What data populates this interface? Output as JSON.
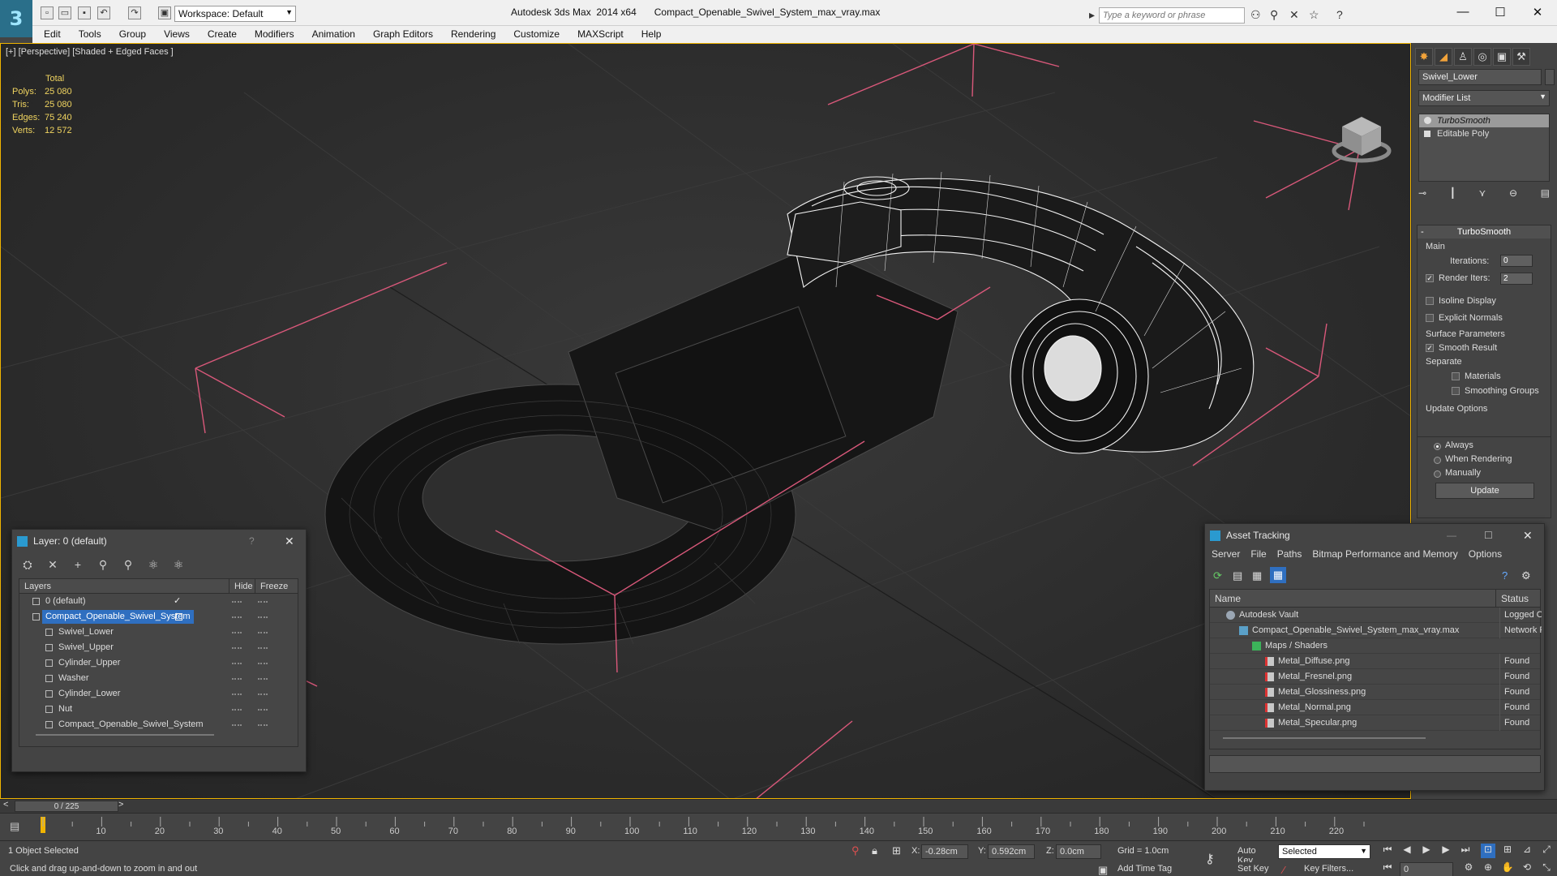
{
  "window": {
    "app_title": "Autodesk 3ds Max  2014 x64",
    "file_title": "Compact_Openable_Swivel_System_max_vray.max",
    "workspace": "Workspace: Default",
    "search_placeholder": "Type a keyword or phrase",
    "logo_glyph": "3"
  },
  "menu": [
    "Edit",
    "Tools",
    "Group",
    "Views",
    "Create",
    "Modifiers",
    "Animation",
    "Graph Editors",
    "Rendering",
    "Customize",
    "MAXScript",
    "Help"
  ],
  "viewport": {
    "label": "[+] [Perspective] [Shaded + Edged Faces ]",
    "stats_header": "Total",
    "stats": [
      {
        "label": "Polys:",
        "value": "25 080"
      },
      {
        "label": "Tris:",
        "value": "25 080"
      },
      {
        "label": "Edges:",
        "value": "75 240"
      },
      {
        "label": "Verts:",
        "value": "12 572"
      }
    ]
  },
  "command_panel": {
    "object_name": "Swivel_Lower",
    "modifier_list": "Modifier List",
    "stack": [
      "TurboSmooth",
      "Editable Poly"
    ],
    "rollout_title": "TurboSmooth",
    "main_label": "Main",
    "iterations_label": "Iterations:",
    "iterations_value": "0",
    "render_iters_label": "Render Iters:",
    "render_iters_value": "2",
    "render_iters_checked": "✓",
    "isoline_label": "Isoline Display",
    "explicit_normals_label": "Explicit Normals",
    "surface_params_label": "Surface Parameters",
    "smooth_result_label": "Smooth Result",
    "smooth_result_checked": "✓",
    "separate_label": "Separate",
    "materials_label": "Materials",
    "smoothing_groups_label": "Smoothing Groups",
    "update_options_label": "Update Options",
    "update_always": "Always",
    "update_when_rendering": "When Rendering",
    "update_manually": "Manually",
    "update_button": "Update"
  },
  "layer_dialog": {
    "title": "Layer: 0 (default)",
    "help": "?",
    "col_layers": "Layers",
    "col_hide": "Hide",
    "col_freeze": "Freeze",
    "rows": [
      {
        "name": "0 (default)",
        "indent": 0,
        "kind": "layer"
      },
      {
        "name": "Compact_Openable_Swivel_System",
        "indent": 0,
        "kind": "layer"
      },
      {
        "name": "Swivel_Lower",
        "indent": 1,
        "kind": "object"
      },
      {
        "name": "Swivel_Upper",
        "indent": 1,
        "kind": "object"
      },
      {
        "name": "Cylinder_Upper",
        "indent": 1,
        "kind": "object"
      },
      {
        "name": "Washer",
        "indent": 1,
        "kind": "object"
      },
      {
        "name": "Cylinder_Lower",
        "indent": 1,
        "kind": "object"
      },
      {
        "name": "Nut",
        "indent": 1,
        "kind": "object"
      },
      {
        "name": "Compact_Openable_Swivel_System",
        "indent": 1,
        "kind": "object"
      }
    ]
  },
  "asset_dialog": {
    "title": "Asset Tracking",
    "menu": [
      "Server",
      "File",
      "Paths",
      "Bitmap Performance and Memory",
      "Options"
    ],
    "col_name": "Name",
    "col_status": "Status",
    "rows": [
      {
        "name": "Autodesk Vault",
        "status": "Logged O",
        "indent": 1,
        "icon": "vault"
      },
      {
        "name": "Compact_Openable_Swivel_System_max_vray.max",
        "status": "Network F",
        "indent": 2,
        "icon": "max"
      },
      {
        "name": "Maps / Shaders",
        "status": "",
        "indent": 3,
        "icon": "folder"
      },
      {
        "name": "Metal_Diffuse.png",
        "status": "Found",
        "indent": 4,
        "icon": "png"
      },
      {
        "name": "Metal_Fresnel.png",
        "status": "Found",
        "indent": 4,
        "icon": "png"
      },
      {
        "name": "Metal_Glossiness.png",
        "status": "Found",
        "indent": 4,
        "icon": "png"
      },
      {
        "name": "Metal_Normal.png",
        "status": "Found",
        "indent": 4,
        "icon": "png"
      },
      {
        "name": "Metal_Specular.png",
        "status": "Found",
        "indent": 4,
        "icon": "png"
      }
    ]
  },
  "timeline": {
    "frame_range": "0 / 225",
    "ticks": [
      "10",
      "20",
      "30",
      "40",
      "50",
      "60",
      "70",
      "80",
      "90",
      "100",
      "110",
      "120",
      "130",
      "140",
      "150",
      "160",
      "170",
      "180",
      "190",
      "200",
      "210",
      "220"
    ]
  },
  "status": {
    "selection": "1 Object Selected",
    "prompt": "Click and drag up-and-down to zoom in and out",
    "x_label": "X:",
    "x_value": "-0.28cm",
    "y_label": "Y:",
    "y_value": "0.592cm",
    "z_label": "Z:",
    "z_value": "0.0cm",
    "grid": "Grid = 1.0cm",
    "add_time_tag": "Add Time Tag",
    "auto_key": "Auto Key",
    "set_key": "Set Key",
    "selected_dropdown": "Selected",
    "key_filters": "Key Filters...",
    "frame_value": "0"
  },
  "colors": {
    "accent": "#f0b400",
    "selection": "#2f6fc0",
    "bracket": "#d9587a"
  }
}
